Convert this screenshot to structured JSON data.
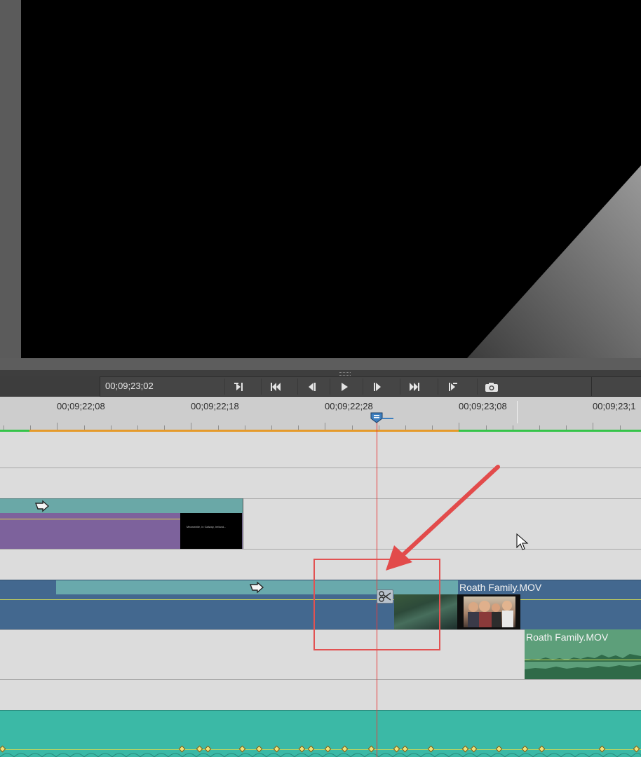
{
  "monitor": {
    "current_time": "00;09;23;02"
  },
  "transport": {
    "buttons": [
      {
        "id": "goto-in",
        "icon": "goto-in-point-icon",
        "glyph": "⇤"
      },
      {
        "id": "goto-prev-edit",
        "icon": "skip-previous-icon",
        "glyph": "⏮"
      },
      {
        "id": "step-back",
        "icon": "step-back-icon",
        "glyph": "◀|"
      },
      {
        "id": "play",
        "icon": "play-icon",
        "glyph": "▶"
      },
      {
        "id": "step-forward",
        "icon": "step-forward-icon",
        "glyph": "|▶"
      },
      {
        "id": "goto-next-edit",
        "icon": "skip-next-icon",
        "glyph": "⏭"
      },
      {
        "id": "goto-out",
        "icon": "goto-out-point-icon",
        "glyph": "⇥"
      },
      {
        "id": "snapshot",
        "icon": "camera-icon",
        "glyph": "📷"
      }
    ]
  },
  "ruler": {
    "labels": [
      "00;09;22;08",
      "00;09;22;18",
      "00;09;22;28",
      "00;09;23;08",
      "00;09;23;1"
    ]
  },
  "clips": {
    "title_thumb_text": "Meanwhile, in Galway, Ireland...",
    "video_clip_name": "Roath Family.MOV",
    "audio_clip_name": "Roath Family.MOV"
  },
  "colors": {
    "playhead": "#e83b3b",
    "annotation": "#e25252",
    "title_clip": "#7d629c",
    "video_track": "#43688f",
    "audio_clip": "#5d9f7a",
    "music_track": "#3bb9a6"
  }
}
